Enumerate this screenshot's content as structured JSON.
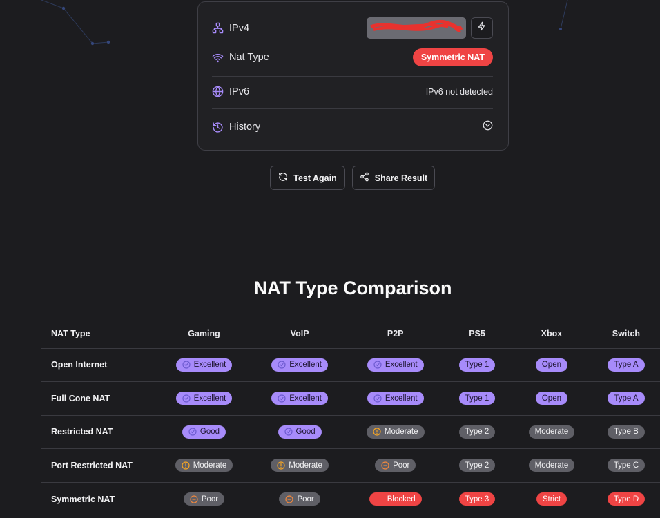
{
  "colors": {
    "accent": "#a78bfa",
    "danger": "#ef4444",
    "neutral": "#5f5f66",
    "warning": "#f59e0b"
  },
  "card": {
    "ipv4": {
      "label": "IPv4",
      "value": "[redacted]"
    },
    "nat": {
      "label": "Nat Type",
      "value": "Symmetric NAT"
    },
    "ipv6": {
      "label": "IPv6",
      "value": "IPv6 not detected"
    },
    "history": {
      "label": "History"
    }
  },
  "actions": {
    "test_again": "Test Again",
    "share_result": "Share Result"
  },
  "comparison": {
    "title": "NAT Type Comparison",
    "headers": [
      "NAT Type",
      "Gaming",
      "VoIP",
      "P2P",
      "PS5",
      "Xbox",
      "Switch"
    ],
    "rows": [
      {
        "name": "Open Internet",
        "cells": [
          {
            "text": "Excellent",
            "tone": "purple",
            "icon": "check-circle-icon"
          },
          {
            "text": "Excellent",
            "tone": "purple",
            "icon": "check-circle-icon"
          },
          {
            "text": "Excellent",
            "tone": "purple",
            "icon": "check-circle-icon"
          },
          {
            "text": "Type 1",
            "tone": "purple",
            "icon": ""
          },
          {
            "text": "Open",
            "tone": "purple",
            "icon": ""
          },
          {
            "text": "Type A",
            "tone": "purple",
            "icon": ""
          }
        ]
      },
      {
        "name": "Full Cone NAT",
        "cells": [
          {
            "text": "Excellent",
            "tone": "purple",
            "icon": "check-circle-icon"
          },
          {
            "text": "Excellent",
            "tone": "purple",
            "icon": "check-circle-icon"
          },
          {
            "text": "Excellent",
            "tone": "purple",
            "icon": "check-circle-icon"
          },
          {
            "text": "Type 1",
            "tone": "purple",
            "icon": ""
          },
          {
            "text": "Open",
            "tone": "purple",
            "icon": ""
          },
          {
            "text": "Type A",
            "tone": "purple",
            "icon": ""
          }
        ]
      },
      {
        "name": "Restricted NAT",
        "cells": [
          {
            "text": "Good",
            "tone": "purple",
            "icon": "check-circle-icon"
          },
          {
            "text": "Good",
            "tone": "purple",
            "icon": "check-circle-icon"
          },
          {
            "text": "Moderate",
            "tone": "gray",
            "icon": "alert-circle-icon"
          },
          {
            "text": "Type 2",
            "tone": "gray",
            "icon": ""
          },
          {
            "text": "Moderate",
            "tone": "gray",
            "icon": ""
          },
          {
            "text": "Type B",
            "tone": "gray",
            "icon": ""
          }
        ]
      },
      {
        "name": "Port Restricted NAT",
        "cells": [
          {
            "text": "Moderate",
            "tone": "gray",
            "icon": "alert-circle-icon"
          },
          {
            "text": "Moderate",
            "tone": "gray",
            "icon": "alert-circle-icon"
          },
          {
            "text": "Poor",
            "tone": "gray",
            "icon": "minus-circle-icon"
          },
          {
            "text": "Type 2",
            "tone": "gray",
            "icon": ""
          },
          {
            "text": "Moderate",
            "tone": "gray",
            "icon": ""
          },
          {
            "text": "Type C",
            "tone": "gray",
            "icon": ""
          }
        ]
      },
      {
        "name": "Symmetric NAT",
        "cells": [
          {
            "text": "Poor",
            "tone": "gray",
            "icon": "minus-circle-icon"
          },
          {
            "text": "Poor",
            "tone": "gray",
            "icon": "minus-circle-icon"
          },
          {
            "text": "Blocked",
            "tone": "red",
            "icon": "x-circle-icon"
          },
          {
            "text": "Type 3",
            "tone": "red",
            "icon": ""
          },
          {
            "text": "Strict",
            "tone": "red",
            "icon": ""
          },
          {
            "text": "Type D",
            "tone": "red",
            "icon": ""
          }
        ]
      }
    ]
  }
}
